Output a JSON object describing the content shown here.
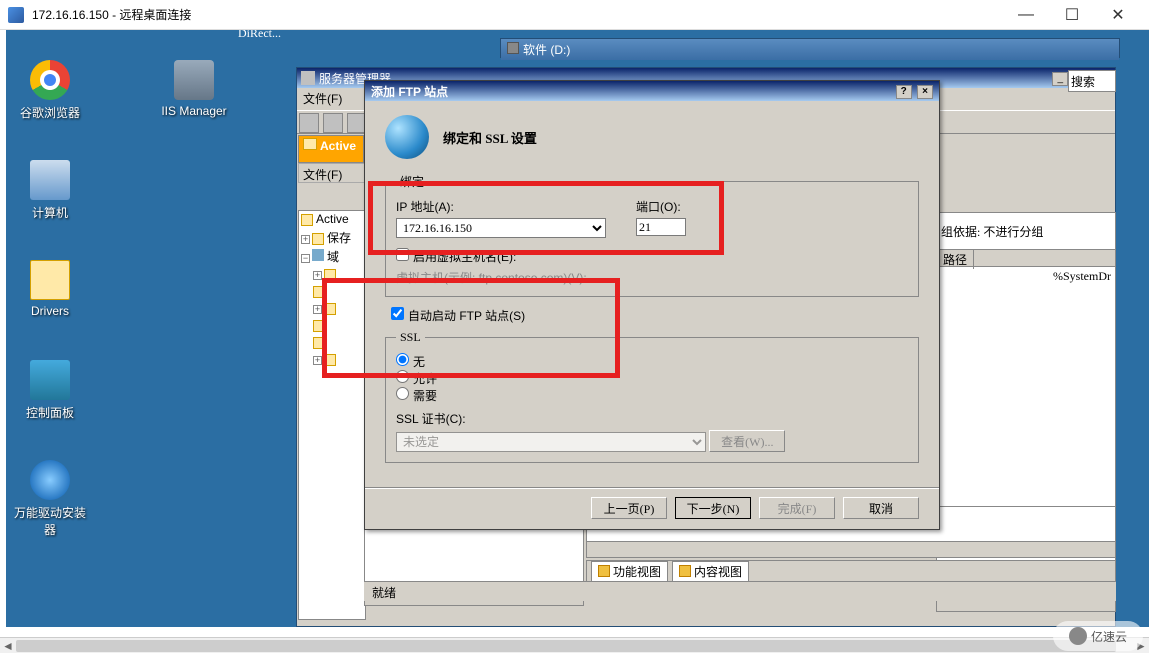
{
  "rdp": {
    "title": "172.16.16.150 - 远程桌面连接"
  },
  "desktop_icons": {
    "chrome": "谷歌浏览器",
    "iis": "IIS Manager",
    "computer": "计算机",
    "drivers": "Drivers",
    "ctrl_panel": "控制面板",
    "driver_inst": "万能驱动安装器",
    "direct": "DiRect..."
  },
  "explorer1": {
    "title": "软件 (D:)"
  },
  "server_mgr": {
    "title": "服务器管理器",
    "menu_file": "文件(F)",
    "ad_panel": "Active",
    "menu_file2": "文件(F)",
    "tree": {
      "root": "Active",
      "item1": "保存",
      "item2": "域",
      "sub_items": [
        "",
        "",
        "",
        "",
        "",
        ""
      ]
    },
    "right": {
      "group_label": "组依据: 不进行分组",
      "col_path": "路径",
      "path_value": "%SystemDr"
    },
    "search_placeholder": "搜索"
  },
  "dialog": {
    "title": "添加 FTP 站点",
    "heading": "绑定和 SSL 设置",
    "bind_group": "绑定",
    "ip_label": "IP 地址(A):",
    "ip_value": "172.16.16.150",
    "port_label": "端口(O):",
    "port_value": "21",
    "vhost_chk": "启用虚拟主机名(E):",
    "vhost_hint": "虚拟主机(示例: ftp.contoso.com)(V):",
    "auto_start": "自动启动 FTP 站点(S)",
    "ssl_group": "SSL",
    "ssl_none": "无",
    "ssl_allow": "允许",
    "ssl_require": "需要",
    "ssl_cert_label": "SSL 证书(C):",
    "ssl_cert_value": "未选定",
    "view_btn": "查看(W)...",
    "prev": "上一页(P)",
    "next": "下一步(N)",
    "finish": "完成(F)",
    "cancel": "取消"
  },
  "bottom_tabs": {
    "tab1": "功能视图",
    "tab2": "内容视图"
  },
  "status": "就绪",
  "watermark": "亿速云"
}
